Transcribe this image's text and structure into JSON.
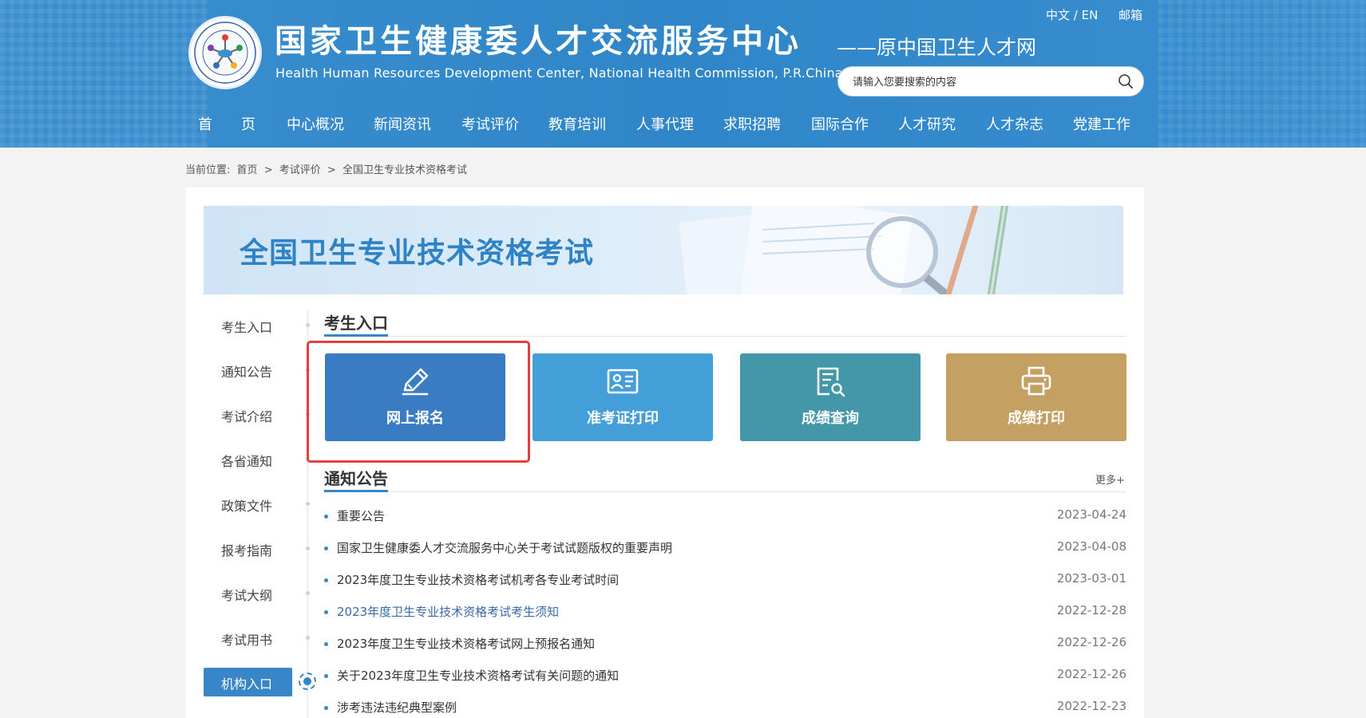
{
  "header": {
    "title": "国家卫生健康委人才交流服务中心",
    "subtitle": "Health Human Resources Development Center, National Health Commission, P.R.China",
    "slogan": "——原中国卫生人才网",
    "lang_switch": "中文 / EN",
    "mail": "邮箱",
    "search_placeholder": "请输入您要搜索的内容"
  },
  "nav": [
    "首　　页",
    "中心概况",
    "新闻资讯",
    "考试评价",
    "教育培训",
    "人事代理",
    "求职招聘",
    "国际合作",
    "人才研究",
    "人才杂志",
    "党建工作"
  ],
  "breadcrumb": {
    "label": "当前位置:",
    "items": [
      "首页",
      ">",
      "考试评价",
      ">",
      "全国卫生专业技术资格考试"
    ]
  },
  "banner": {
    "title": "全国卫生专业技术资格考试"
  },
  "sidebar": {
    "items": [
      "考生入口",
      "通知公告",
      "考试介绍",
      "各省通知",
      "政策文件",
      "报考指南",
      "考试大纲",
      "考试用书"
    ],
    "active": "机构入口"
  },
  "entry": {
    "heading": "考生入口",
    "tiles": [
      {
        "label": "网上报名",
        "color": "#3a7cc4",
        "icon": "pen-icon"
      },
      {
        "label": "准考证打印",
        "color": "#449fd9",
        "icon": "id-card-icon"
      },
      {
        "label": "成绩查询",
        "color": "#4497a8",
        "icon": "document-search-icon"
      },
      {
        "label": "成绩打印",
        "color": "#c4a063",
        "icon": "printer-icon"
      }
    ]
  },
  "notices": {
    "heading": "通知公告",
    "more": "更多+",
    "items": [
      {
        "title": "重要公告",
        "date": "2023-04-24"
      },
      {
        "title": "国家卫生健康委人才交流服务中心关于考试试题版权的重要声明",
        "date": "2023-04-08"
      },
      {
        "title": "2023年度卫生专业技术资格考试机考各专业考试时间",
        "date": "2023-03-01"
      },
      {
        "title": "2023年度卫生专业技术资格考试考生须知",
        "date": "2022-12-28"
      },
      {
        "title": "2023年度卫生专业技术资格考试网上预报名通知",
        "date": "2022-12-26"
      },
      {
        "title": "关于2023年度卫生专业技术资格考试有关问题的通知",
        "date": "2022-12-26"
      },
      {
        "title": "涉考违法违纪典型案例",
        "date": "2022-12-23"
      }
    ]
  }
}
